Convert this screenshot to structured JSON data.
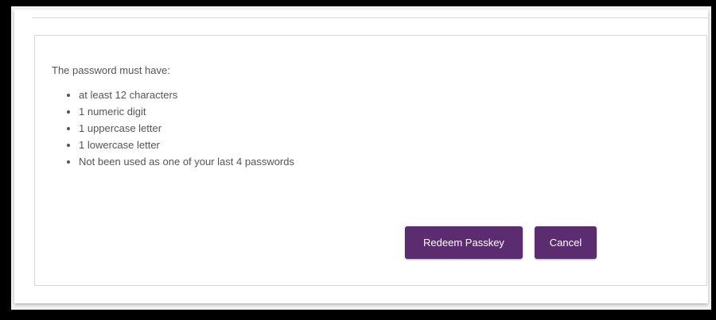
{
  "password_rules": {
    "intro": "The password must have:",
    "items": [
      "at least 12 characters",
      "1 numeric digit",
      "1 uppercase letter",
      "1 lowercase letter",
      "Not been used as one of your last 4 passwords"
    ]
  },
  "actions": {
    "redeem_label": "Redeem Passkey",
    "cancel_label": "Cancel"
  },
  "colors": {
    "button_bg": "#5b2c6f",
    "text": "#555555"
  }
}
